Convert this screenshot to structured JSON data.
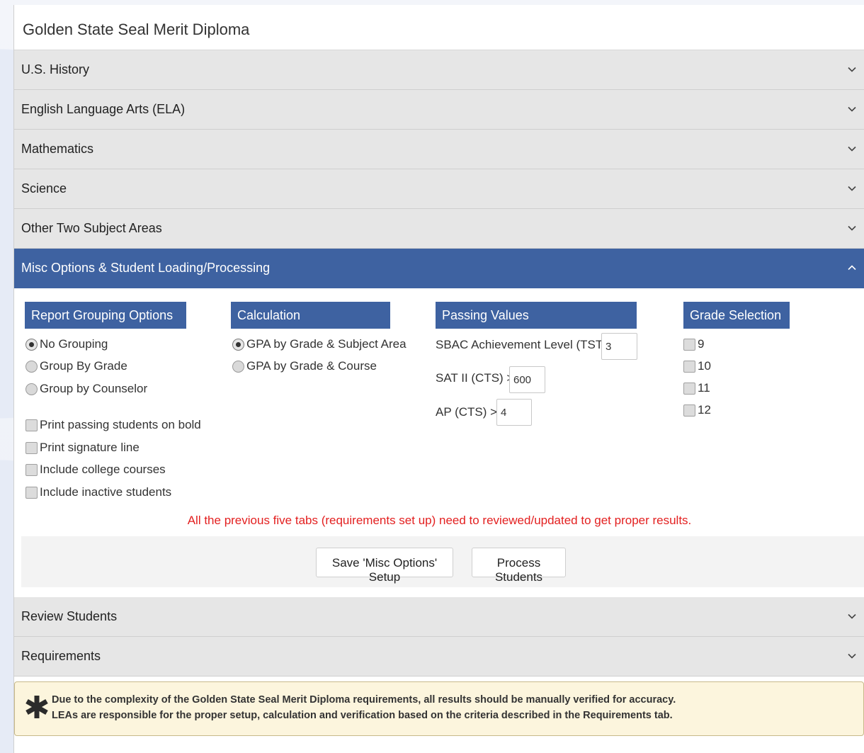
{
  "panel": {
    "title": "Golden State Seal Merit Diploma"
  },
  "accordion": {
    "sections_top": [
      {
        "label": "U.S. History"
      },
      {
        "label": "English Language Arts (ELA)"
      },
      {
        "label": "Mathematics"
      },
      {
        "label": "Science"
      },
      {
        "label": "Other Two Subject Areas"
      }
    ],
    "active": {
      "label": "Misc Options & Student Loading/Processing"
    },
    "sections_bottom": [
      {
        "label": "Review Students"
      },
      {
        "label": "Requirements"
      }
    ]
  },
  "misc": {
    "report_grouping": {
      "title": "Report Grouping Options",
      "options": [
        "No Grouping",
        "Group By Grade",
        "Group by Counselor"
      ],
      "selected": "No Grouping"
    },
    "print_options": [
      "Print passing students on bold",
      "Print signature line",
      "Include college courses",
      "Include inactive students"
    ],
    "calculation": {
      "title": "Calculation",
      "options": [
        "GPA by Grade & Subject Area",
        "GPA by Grade & Course"
      ],
      "selected": "GPA by Grade & Subject Area"
    },
    "passing_values": {
      "title": "Passing Values",
      "sbac": {
        "label": "SBAC Achievement Level (TST) >=",
        "value": "3"
      },
      "sat": {
        "label": "SAT II (CTS) >=",
        "value": "600"
      },
      "ap": {
        "label": "AP (CTS) >=",
        "value": "4"
      }
    },
    "grade_selection": {
      "title": "Grade Selection",
      "grades": [
        "9",
        "10",
        "11",
        "12"
      ]
    },
    "warning": "All the previous five tabs (requirements set up) need to reviewed/updated to get proper results.",
    "buttons": {
      "save": "Save 'Misc Options' Setup",
      "process": "Process Students"
    }
  },
  "notice": {
    "line1": "Due to the complexity of the Golden State Seal Merit Diploma requirements, all results should be manually verified for accuracy.",
    "line2": "LEAs are responsible for the proper setup, calculation and verification based on the criteria described in the Requirements tab."
  },
  "colors": {
    "accent": "#3e62a1",
    "warning": "#e32020",
    "notice_bg": "#fcf5dd",
    "star": "#2b2b2b"
  }
}
